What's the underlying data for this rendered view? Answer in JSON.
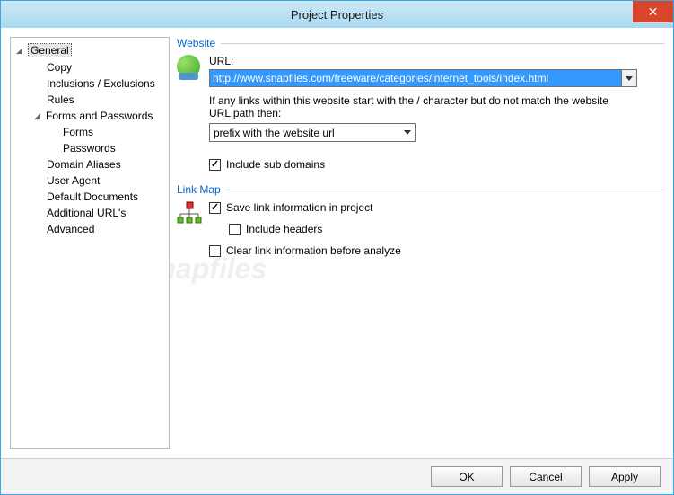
{
  "window": {
    "title": "Project Properties"
  },
  "tree": {
    "items": [
      {
        "label": "General",
        "level": 0,
        "expander": "◢",
        "selected": true
      },
      {
        "label": "Copy",
        "level": 1
      },
      {
        "label": "Inclusions / Exclusions",
        "level": 1
      },
      {
        "label": "Rules",
        "level": 1
      },
      {
        "label": "Forms and Passwords",
        "level": 1,
        "expander": "◢"
      },
      {
        "label": "Forms",
        "level": 2
      },
      {
        "label": "Passwords",
        "level": 2
      },
      {
        "label": "Domain Aliases",
        "level": 1
      },
      {
        "label": "User Agent",
        "level": 1
      },
      {
        "label": "Default Documents",
        "level": 1
      },
      {
        "label": "Additional URL's",
        "level": 1
      },
      {
        "label": "Advanced",
        "level": 1
      }
    ]
  },
  "website": {
    "section_title": "Website",
    "url_label": "URL:",
    "url_value": "http://www.snapfiles.com/freeware/categories/internet_tools/index.html",
    "note": "If any links within this website start with the / character but do not match the website URL path then:",
    "prefix_option": "prefix with the website url",
    "include_subdomains_label": "Include sub domains",
    "include_subdomains_checked": true
  },
  "linkmap": {
    "section_title": "Link Map",
    "save_link_info_label": "Save link information in project",
    "save_link_info_checked": true,
    "include_headers_label": "Include headers",
    "include_headers_checked": false,
    "clear_before_analyze_label": "Clear link information before analyze",
    "clear_before_analyze_checked": false
  },
  "footer": {
    "ok": "OK",
    "cancel": "Cancel",
    "apply": "Apply"
  },
  "watermark": "Snapfiles"
}
